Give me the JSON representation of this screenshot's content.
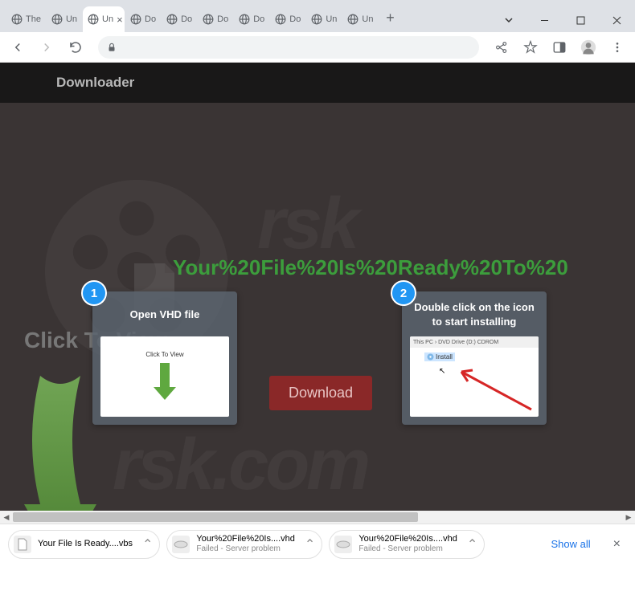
{
  "tabs": [
    {
      "label": "The"
    },
    {
      "label": "Un"
    },
    {
      "label": "Un",
      "active": true
    },
    {
      "label": "Do"
    },
    {
      "label": "Do"
    },
    {
      "label": "Do"
    },
    {
      "label": "Do"
    },
    {
      "label": "Do"
    },
    {
      "label": "Un"
    },
    {
      "label": "Un"
    }
  ],
  "page": {
    "header": "Downloader",
    "headline": "Your%20File%20Is%20Ready%20To%20",
    "click_to_view": "Click To View",
    "download_btn": "Download"
  },
  "cards": [
    {
      "num": "1",
      "title": "Open VHD file",
      "thumb_label": "Click To View"
    },
    {
      "num": "2",
      "title": "Double click on the icon to start installing",
      "path": "This PC › DVD Drive (D:) CDROM",
      "install_label": "Install"
    }
  ],
  "shelf": {
    "items": [
      {
        "name": "Your File Is Ready....vbs",
        "sub": ""
      },
      {
        "name": "Your%20File%20Is....vhd",
        "sub": "Failed - Server problem"
      },
      {
        "name": "Your%20File%20Is....vhd",
        "sub": "Failed - Server problem"
      }
    ],
    "show_all": "Show all"
  }
}
